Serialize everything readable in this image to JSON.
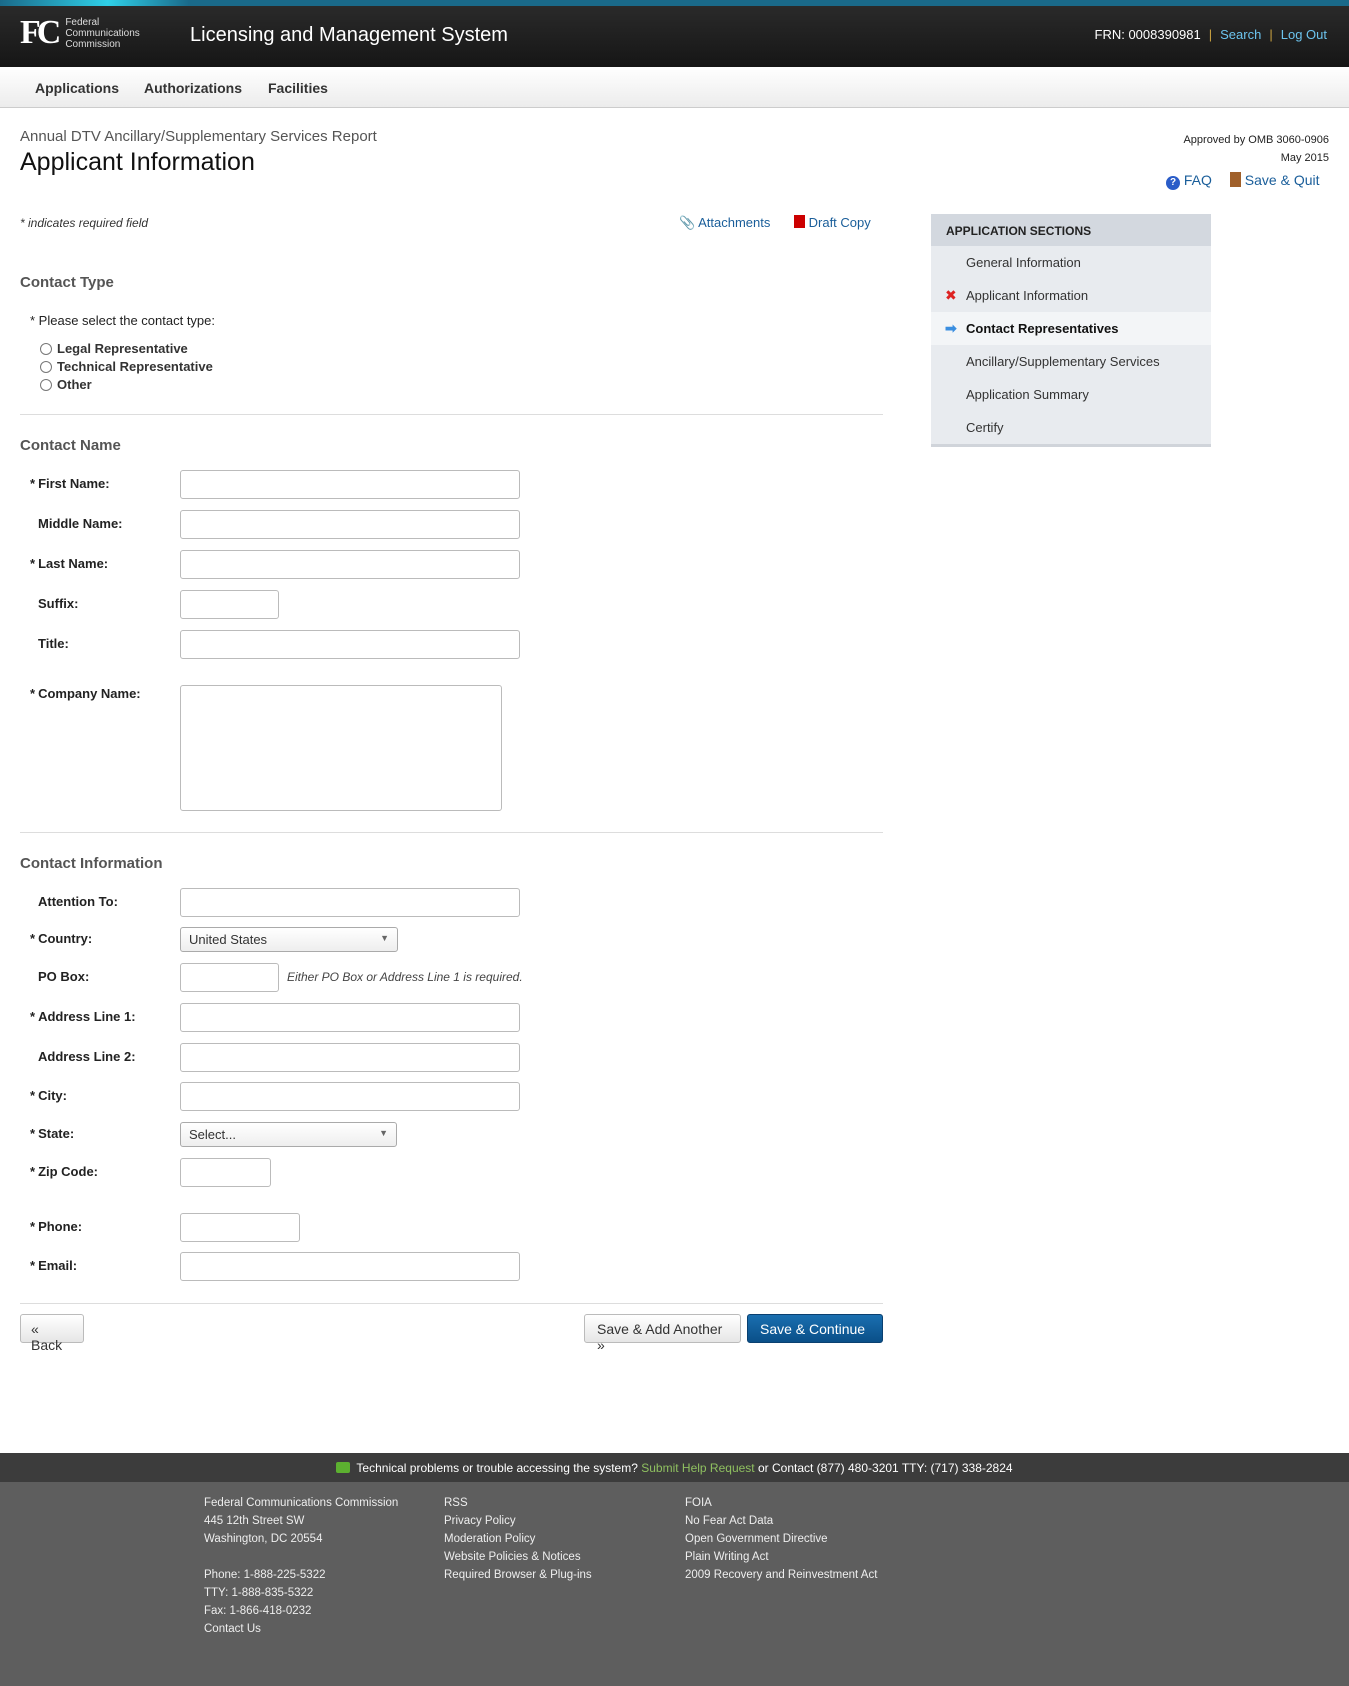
{
  "header": {
    "logo_lines": [
      "Federal",
      "Communications",
      "Commission"
    ],
    "logo_mark": "FCC",
    "title": "Licensing and Management System",
    "frn": "FRN: 0008390981",
    "search": "Search",
    "logout": "Log Out"
  },
  "nav": [
    "Applications",
    "Authorizations",
    "Facilities"
  ],
  "page": {
    "subtitle": "Annual DTV Ancillary/Supplementary Services Report",
    "title": "Applicant Information",
    "approved": "Approved by OMB 3060-0906",
    "date": "May 2015",
    "faq": "FAQ",
    "save_quit": "Save & Quit",
    "required_note": "* indicates required field",
    "attachments": "Attachments",
    "draft_copy": "Draft Copy"
  },
  "sidebar": {
    "title": "APPLICATION SECTIONS",
    "items": [
      {
        "label": "General Information",
        "status": ""
      },
      {
        "label": "Applicant Information",
        "status": "error"
      },
      {
        "label": "Contact Representatives",
        "status": "current"
      },
      {
        "label": "Ancillary/Supplementary Services",
        "status": ""
      },
      {
        "label": "Application Summary",
        "status": ""
      },
      {
        "label": "Certify",
        "status": ""
      }
    ]
  },
  "contact_type": {
    "heading": "Contact Type",
    "prompt": "* Please select the contact type:",
    "options": [
      "Legal Representative",
      "Technical Representative",
      "Other"
    ]
  },
  "contact_name": {
    "heading": "Contact Name",
    "fields": {
      "first": "First Name:",
      "middle": "Middle Name:",
      "last": "Last Name:",
      "suffix": "Suffix:",
      "title": "Title:",
      "company": "Company Name:"
    }
  },
  "contact_info": {
    "heading": "Contact Information",
    "fields": {
      "attention": "Attention To:",
      "country": "Country:",
      "country_value": "United States",
      "pobox": "PO Box:",
      "pobox_note": "Either PO Box or Address Line 1 is required.",
      "addr1": "Address Line 1:",
      "addr2": "Address Line 2:",
      "city": "City:",
      "state": "State:",
      "state_value": "Select...",
      "zip": "Zip Code:",
      "phone": "Phone:",
      "email": "Email:"
    }
  },
  "buttons": {
    "back": "« Back",
    "save_add": "Save & Add Another »",
    "save_continue": "Save & Continue »"
  },
  "footer": {
    "help_text": "Technical problems or trouble accessing the system?",
    "help_link": "Submit Help Request",
    "help_contact": "or Contact (877) 480-3201 TTY: (717) 338-2824",
    "col1": [
      "Federal Communications Commission",
      "445 12th Street SW",
      "Washington, DC 20554",
      "",
      "Phone: 1-888-225-5322",
      "TTY: 1-888-835-5322",
      "Fax: 1-866-418-0232",
      "Contact Us"
    ],
    "col2": [
      "RSS",
      "Privacy Policy",
      "Moderation Policy",
      "Website Policies & Notices",
      "Required Browser & Plug-ins"
    ],
    "col3": [
      "FOIA",
      "No Fear Act Data",
      "Open Government Directive",
      "Plain Writing Act",
      "2009 Recovery and Reinvestment Act"
    ]
  }
}
